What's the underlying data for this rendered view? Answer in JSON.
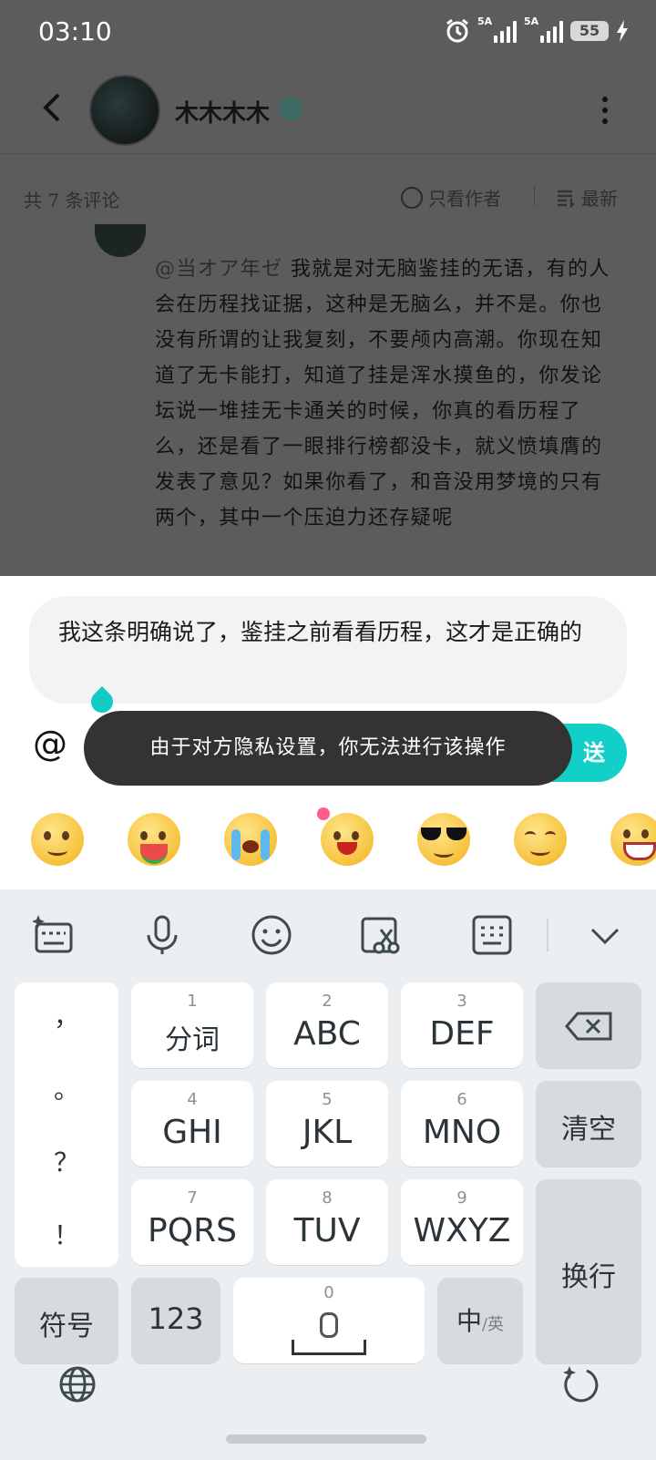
{
  "status_bar": {
    "time": "03:10",
    "signal1_label": "5A",
    "signal2_label": "5A",
    "battery": "55"
  },
  "header": {
    "username": "木木木木",
    "back_icon": "chevron-left-icon",
    "more_icon": "more-vert-icon"
  },
  "comments_bar": {
    "count_text": "共 7 条评论",
    "author_only_label": "只看作者",
    "sort_label": "最新"
  },
  "comment": {
    "mention": "@当オア年ゼ",
    "text": "我就是对无脑鉴挂的无语，有的人会在历程找证据，这种是无脑么，并不是。你也没有所谓的让我复刻，不要颅内高潮。你现在知道了无卡能打，知道了挂是浑水摸鱼的，你发论坛说一堆挂无卡通关的时候，你真的看历程了么，还是看了一眼排行榜都没卡，就义愤填膺的发表了意见？如果你看了，和音没用梦境的只有两个，其中一个压迫力还存疑呢"
  },
  "reply": {
    "input_value": "我这条明确说了，鉴挂之前看看历程，这才是正确的",
    "at_symbol": "@",
    "send_label": "送",
    "toast": "由于对方隐私设置，你无法进行该操作"
  },
  "emojis": [
    "smile-emoji",
    "eating-watermelon-emoji",
    "crying-emoji",
    "heart-wink-emoji",
    "sunglasses-emoji",
    "shy-smile-emoji",
    "grin-emoji"
  ],
  "keyboard": {
    "toolbar": [
      "ai-keyboard-icon",
      "mic-icon",
      "emoji-icon",
      "clipboard-cut-icon",
      "keyboard-layout-icon",
      "collapse-icon"
    ],
    "punctuation": [
      "，",
      "。",
      "？",
      "！"
    ],
    "keys": [
      {
        "num": "1",
        "label": "分词"
      },
      {
        "num": "2",
        "label": "ABC"
      },
      {
        "num": "3",
        "label": "DEF"
      },
      {
        "num": "4",
        "label": "GHI"
      },
      {
        "num": "5",
        "label": "JKL"
      },
      {
        "num": "6",
        "label": "MNO"
      },
      {
        "num": "7",
        "label": "PQRS"
      },
      {
        "num": "8",
        "label": "TUV"
      },
      {
        "num": "9",
        "label": "WXYZ"
      }
    ],
    "clear_label": "清空",
    "enter_label": "换行",
    "symbols_label": "符号",
    "numbers_label": "123",
    "space_num": "0",
    "lang_main": "中",
    "lang_alt": "/英"
  }
}
